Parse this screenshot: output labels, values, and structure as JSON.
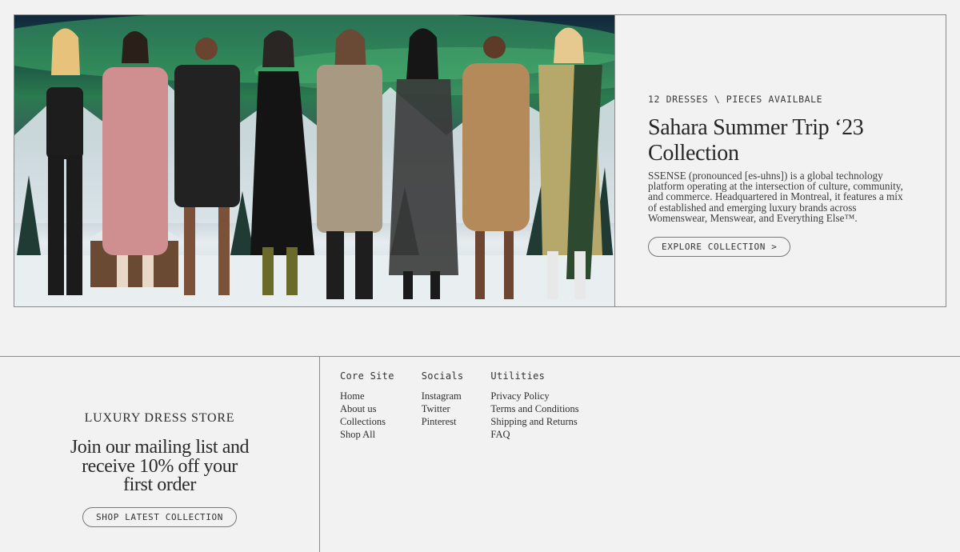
{
  "feature": {
    "eyebrow": "12 DRESSES \\ PIECES AVAILBALE",
    "title": "Sahara Summer Trip ‘23 Collection",
    "description": "SSENSE (pronounced [es-uhns]) is a global technology platform operating at the intersection of culture, community, and commerce. Headquartered in Montreal, it features a mix of established and emerging luxury brands across Womenswear, Menswear, and Everything Else™.",
    "cta_label": "EXPLORE COLLECTION >",
    "image_label": "collection-models-photo"
  },
  "footer": {
    "store_name": "LUXURY DRESS STORE",
    "mailing_text": "Join our mailing list and receive 10% off your first order",
    "cta_label": "SHOP LATEST COLLECTION",
    "columns": [
      {
        "heading": "Core Site",
        "links": [
          "Home",
          "About us",
          "Collections",
          "Shop All"
        ]
      },
      {
        "heading": "Socials",
        "links": [
          "Instagram",
          "Twitter",
          "Pinterest"
        ]
      },
      {
        "heading": "Utilities",
        "links": [
          "Privacy Policy",
          "Terms and Conditions",
          "Shipping and Returns",
          "FAQ"
        ]
      }
    ]
  },
  "colors": {
    "background": "#f2f2f2",
    "border": "#8a8a8a",
    "text": "#2a2a2a"
  }
}
